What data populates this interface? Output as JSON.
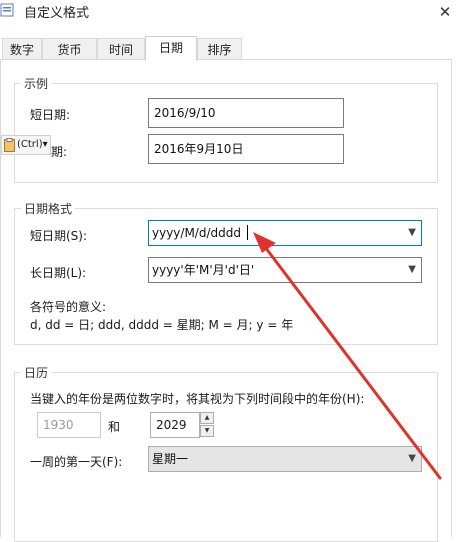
{
  "window": {
    "title": "自定义格式",
    "close_glyph": "✕"
  },
  "tabs": [
    {
      "label": "数字"
    },
    {
      "label": "货币"
    },
    {
      "label": "时间"
    },
    {
      "label": "日期"
    },
    {
      "label": "排序"
    }
  ],
  "active_tab": "日期",
  "example": {
    "title": "示例",
    "short_label": "短日期:",
    "short_value": "2016/9/10",
    "long_label": "期:",
    "long_value": "2016年9月10日"
  },
  "paste_badge": {
    "text": "(Ctrl)▾",
    "icon": "clipboard-icon"
  },
  "date_formats": {
    "title": "日期格式",
    "short_label": "短日期(S):",
    "short_value": "yyyy/M/d/dddd",
    "long_label": "长日期(L):",
    "long_value": "yyyy'年'M'月'd'日'",
    "meaning_title": "各符号的意义:",
    "meaning_text": "d, dd = 日;  ddd, dddd = 星期;  M = 月;  y = 年"
  },
  "calendar": {
    "title": "日历",
    "two_digit_text": "当键入的年份是两位数字时，将其视为下列时间段中的年份(H):",
    "from_year": "1930",
    "and_label": "和",
    "to_year": "2029",
    "first_day_label": "一周的第一天(F):",
    "first_day_value": "星期一"
  },
  "annotation": {
    "arrow_color": "#e0322d"
  },
  "colors": {
    "focus": "#0078d7",
    "border": "#7a7a7a"
  }
}
